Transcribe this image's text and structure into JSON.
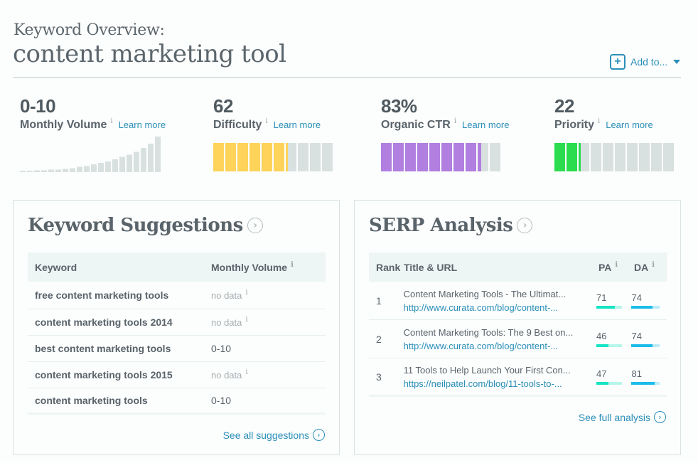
{
  "header": {
    "overview_label": "Keyword Overview:",
    "keyword": "content marketing tool",
    "add_to_label": "Add to...",
    "add_icon": "plus-icon",
    "caret_icon": "caret-down-icon"
  },
  "metrics": [
    {
      "id": "volume",
      "value": "0-10",
      "name": "Monthly Volume",
      "info": "i",
      "learn_more": "Learn more"
    },
    {
      "id": "difficulty",
      "value": "62",
      "name": "Difficulty",
      "info": "i",
      "learn_more": "Learn more",
      "percent": 62,
      "color": "#fdd35a"
    },
    {
      "id": "ctr",
      "value": "83%",
      "name": "Organic CTR",
      "info": "i",
      "learn_more": "Learn more",
      "percent": 83,
      "color": "#b07fe0"
    },
    {
      "id": "priority",
      "value": "22",
      "name": "Priority",
      "info": "i",
      "learn_more": "Learn more",
      "percent": 22,
      "color": "#2bdc4f"
    }
  ],
  "volume_trend": [
    3,
    3,
    5,
    5,
    7,
    7,
    9,
    11,
    15,
    17,
    22,
    26,
    30,
    36,
    43,
    49,
    57,
    68,
    80,
    100
  ],
  "colors": {
    "empty_segment": "#d8e1e0",
    "spark_bar": "#d8e1e0",
    "link": "#2a8fb8",
    "pa_fill": "#16e4c4",
    "pa_track": "#b6f6ea",
    "da_fill": "#1cbbe9",
    "da_track": "#bcecfa"
  },
  "keyword_suggestions": {
    "title": "Keyword Suggestions",
    "columns": [
      "Keyword",
      "Monthly Volume"
    ],
    "column_info": "i",
    "rows": [
      {
        "keyword": "free content marketing tools",
        "volume": "no data",
        "nodata": true
      },
      {
        "keyword": "content marketing tools 2014",
        "volume": "no data",
        "nodata": true
      },
      {
        "keyword": "best content marketing tools",
        "volume": "0-10",
        "nodata": false
      },
      {
        "keyword": "content marketing tools 2015",
        "volume": "no data",
        "nodata": true
      },
      {
        "keyword": "content marketing tools",
        "volume": "0-10",
        "nodata": false
      }
    ],
    "footer_link": "See all suggestions"
  },
  "serp_analysis": {
    "title": "SERP Analysis",
    "columns": [
      "Rank",
      "Title & URL",
      "PA",
      "DA"
    ],
    "column_info": "i",
    "rows": [
      {
        "rank": "1",
        "title": "Content Marketing Tools - The Ultimat...",
        "url": "http://www.curata.com/blog/content-...",
        "pa": 71,
        "da": 74
      },
      {
        "rank": "2",
        "title": "Content Marketing Tools: The 9 Best on...",
        "url": "http://www.curata.com/blog/content-...",
        "pa": 46,
        "da": 74
      },
      {
        "rank": "3",
        "title": "11 Tools to Help Launch Your First Con...",
        "url": "https://neilpatel.com/blog/11-tools-to-...",
        "pa": 47,
        "da": 81
      }
    ],
    "footer_link": "See full analysis"
  }
}
